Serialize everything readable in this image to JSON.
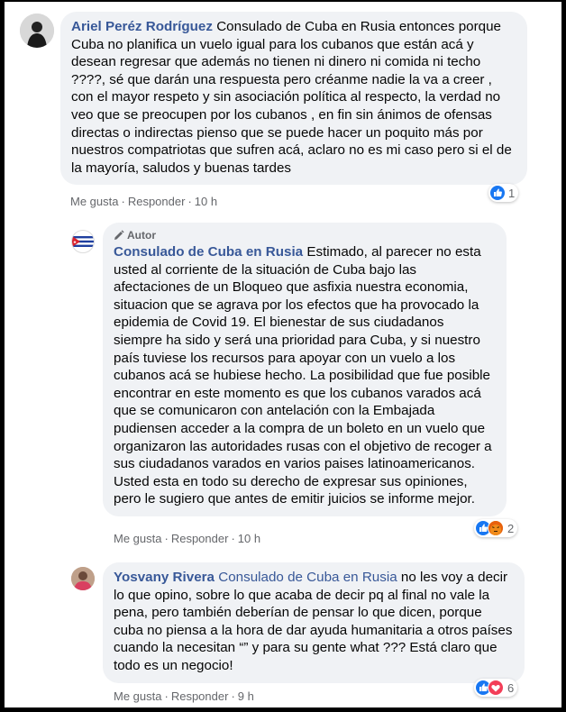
{
  "comments": [
    {
      "author": "Ariel Peréz Rodríguez",
      "text": "Consulado de Cuba en Rusia entonces porque Cuba no planifica un vuelo igual para los cubanos que están acá y desean regresar que además no tienen ni dinero ni comida ni techo ????, sé que darán una respuesta pero créanme nadie la va a creer , con el mayor respeto y sin asociación política al respecto, la verdad no veo que se preocupen por los cubanos , en fin sin ánimos de ofensas directas o indirectas pienso que se puede hacer un poquito más por nuestros compatriotas que sufren acá, aclaro no es mi caso pero si el de la mayoría, saludos y buenas tardes",
      "like": "Me gusta",
      "reply": "Responder",
      "time": "10 h",
      "reaction_count": "1"
    },
    {
      "badge": "Autor",
      "author": "Consulado de Cuba en Rusia",
      "text": "Estimado, al parecer no esta usted al corriente de la situación de Cuba bajo las afectaciones de un Bloqueo que asfixia nuestra economia, situacion que se agrava por los efectos que ha provocado la epidemia de Covid 19. El bienestar de sus ciudadanos siempre ha sido y será una prioridad para Cuba, y si nuestro país tuviese los recursos para apoyar con un vuelo a los cubanos acá se hubiese hecho. La posibilidad que fue posible encontrar en este momento es que los cubanos varados acá que se comunicaron con antelación con la Embajada pudiensen acceder a la compra de un boleto en un vuelo que organizaron las autoridades rusas con el objetivo de recoger a sus ciudadanos varados en varios paises latinoamericanos. Usted esta en todo su derecho de expresar sus opiniones, pero le sugiero que antes de emitir juicios se informe mejor.",
      "like": "Me gusta",
      "reply": "Responder",
      "time": "10 h",
      "reaction_count": "2"
    },
    {
      "author": "Yosvany Rivera",
      "tagged": "Consulado de Cuba en Rusia",
      "text": "no les voy a decir lo que opino, sobre lo que acaba de decir pq al final no vale la pena, pero también deberían de pensar lo que dicen, porque cuba no piensa a la hora de dar ayuda humanitaria a otros países cuando la necesitan “” y para su gente what ??? Está claro que todo es un negocio!",
      "like": "Me gusta",
      "reply": "Responder",
      "time": "9 h",
      "reaction_count": "6"
    }
  ],
  "separator": "·",
  "colors": {
    "link": "#385898",
    "bubble": "#f0f2f5",
    "meta": "#65676b",
    "like": "#1877f2"
  }
}
